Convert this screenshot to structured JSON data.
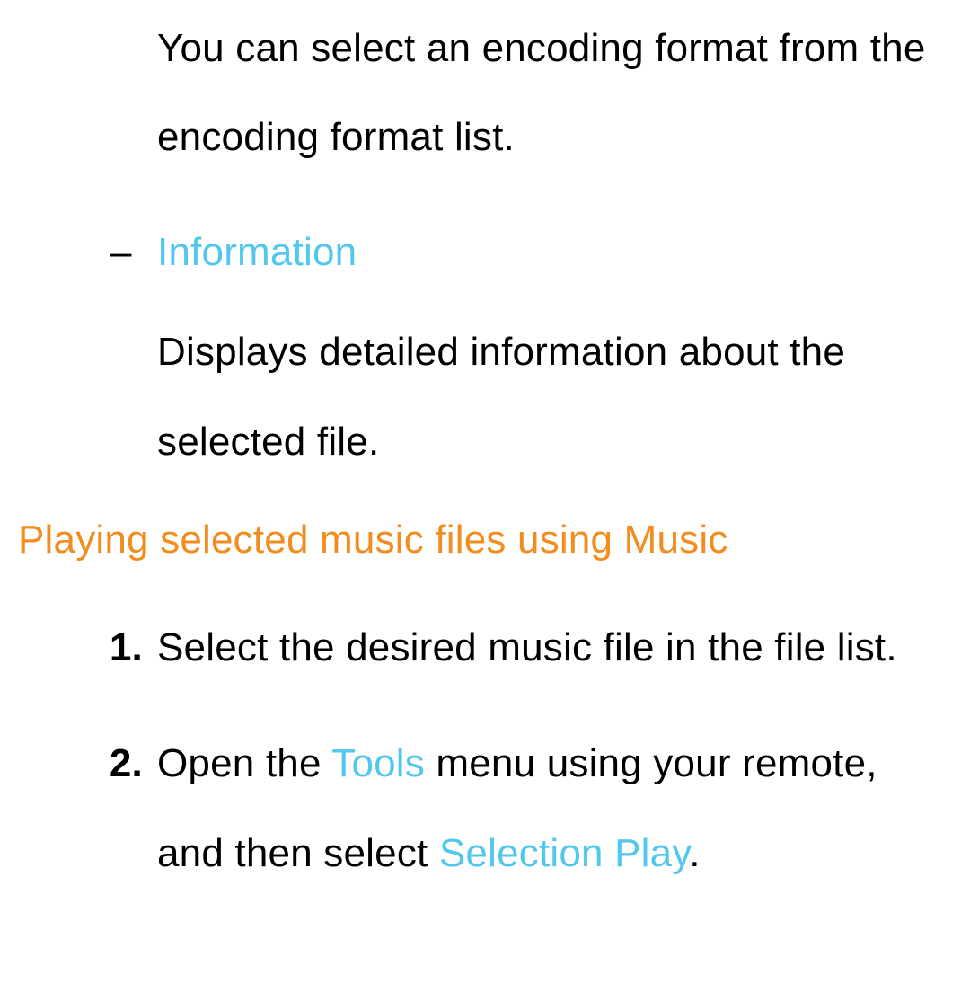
{
  "encoding_paragraph": "You can select an encoding format from the encoding format list.",
  "info_dash": "–",
  "info_heading": "Information",
  "info_paragraph": "Displays detailed information about the selected file.",
  "section_heading": "Playing selected music files using Music",
  "steps": {
    "1": {
      "num": "1.",
      "text": "Select the desired music file in the file list."
    },
    "2": {
      "num": "2.",
      "pre": "Open the ",
      "tools": "Tools",
      "mid": " menu using your remote, and then select ",
      "selection_play": "Selection Play",
      "post": "."
    }
  }
}
